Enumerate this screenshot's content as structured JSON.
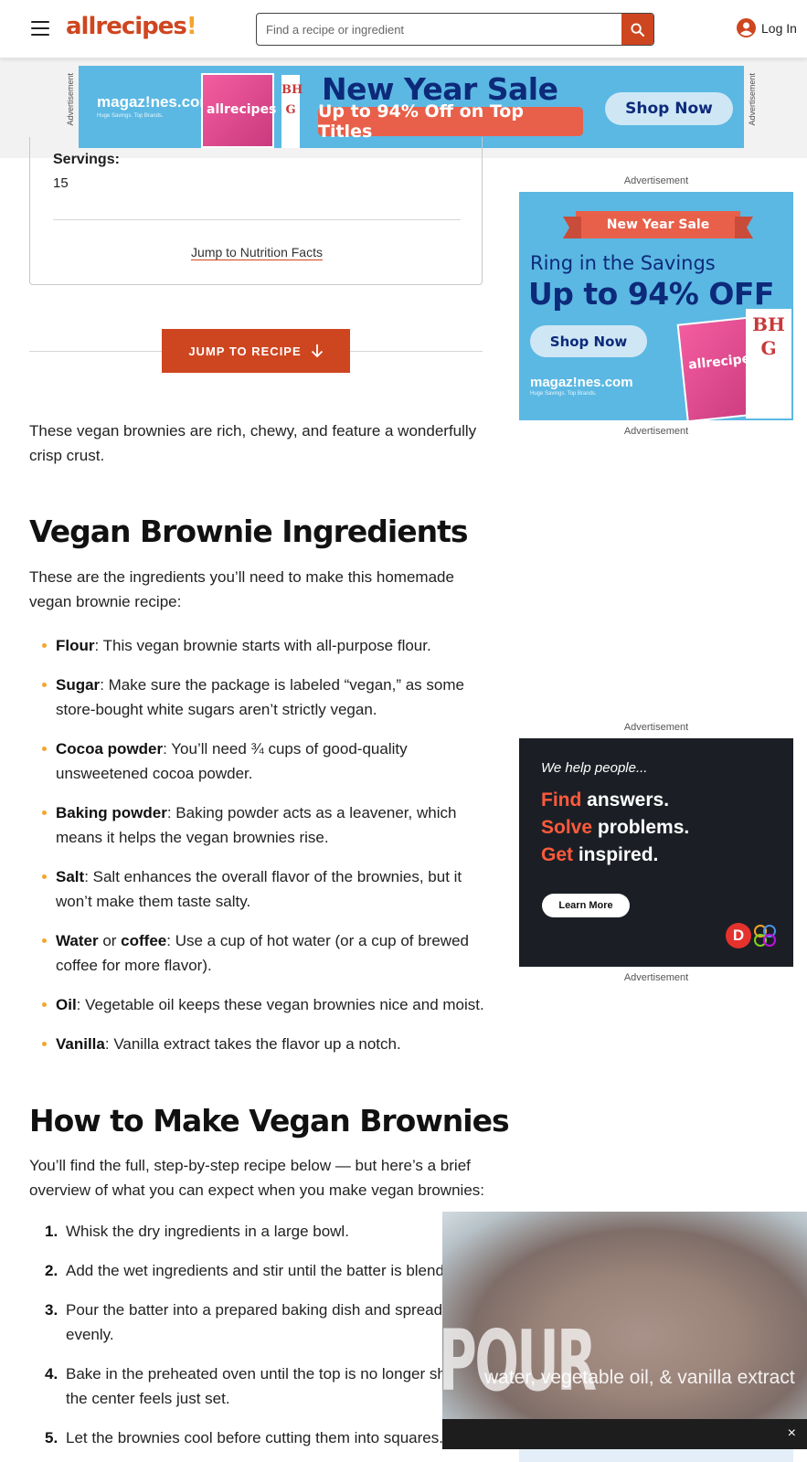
{
  "header": {
    "logo_text": "allrecipes",
    "logo_bang": "!",
    "search_placeholder": "Find a recipe or ingredient",
    "login_label": "Log In"
  },
  "top_ad": {
    "side_label": "Advertisement",
    "brand": "magaz!nes.com",
    "brand_tagline": "Huge Savings. Top Brands.",
    "cover_title": "allrecipes",
    "cover_badge": "BH G",
    "title": "New Year Sale",
    "subtitle": "Up to 94% Off on Top Titles",
    "cta": "Shop Now"
  },
  "recipe_card": {
    "servings_label": "Servings:",
    "servings_value": "15",
    "nutrition_link": "Jump to Nutrition Facts"
  },
  "jump_button": {
    "label": "JUMP TO RECIPE"
  },
  "intro": "These vegan brownies are rich, chewy, and feature a wonderfully crisp crust.",
  "ingredients_section": {
    "heading": "Vegan Brownie Ingredients",
    "intro": "These are the ingredients you’ll need to make this homemade vegan brownie recipe:",
    "items": [
      {
        "term": "Flour",
        "text": ": This vegan brownie starts with all-purpose flour."
      },
      {
        "term": "Sugar",
        "text": ": Make sure the package is labeled “vegan,” as some store-bought white sugars aren’t strictly vegan."
      },
      {
        "term": "Cocoa powder",
        "text": ": You’ll need ¾ cups of good-quality unsweetened cocoa powder."
      },
      {
        "term": "Baking powder",
        "text": ": Baking powder acts as a leavener, which means it helps the vegan brownies rise."
      },
      {
        "term": "Salt",
        "text": ": Salt enhances the overall flavor of the brownies, but it won’t make them taste salty."
      },
      {
        "term": "Water",
        "joiner": " or ",
        "term2": "coffee",
        "text": ": Use a cup of hot water (or a cup of brewed coffee for more flavor)."
      },
      {
        "term": "Oil",
        "text": ": Vegetable oil keeps these vegan brownies nice and moist."
      },
      {
        "term": "Vanilla",
        "text": ": Vanilla extract takes the flavor up a notch."
      }
    ]
  },
  "method_section": {
    "heading": "How to Make Vegan Brownies",
    "intro": "You’ll find the full, step-by-step recipe below — but here’s a brief overview of what you can expect when you make vegan brownies:",
    "steps": [
      {
        "num": "1.",
        "text": "Whisk the dry ingredients in a large bowl."
      },
      {
        "num": "2.",
        "text": "Add the wet ingredients and stir until the batter is blend"
      },
      {
        "num": "3.",
        "text": "Pour the batter into a prepared baking dish and spread it evenly."
      },
      {
        "num": "4.",
        "text": "Bake in the preheated oven until the top is no longer sh and the center feels just set."
      },
      {
        "num": "5.",
        "text": "Let the brownies cool before cutting them into squares."
      }
    ]
  },
  "side_ads": {
    "label": "Advertisement",
    "ad1": {
      "ribbon": "New Year Sale",
      "line1": "Ring in the Savings",
      "line2": "Up to 94% OFF",
      "cta": "Shop Now",
      "brand": "magaz!nes.com",
      "brand_tagline": "Huge Savings. Top Brands.",
      "cover_title": "allrecipes",
      "cover_badge": "BH G"
    },
    "ad2": {
      "tagline": "We help people...",
      "lines": [
        {
          "accent": "Find",
          "rest": " answers."
        },
        {
          "accent": "Solve",
          "rest": " problems."
        },
        {
          "accent": "Get",
          "rest": " inspired."
        }
      ],
      "cta": "Learn More",
      "logo_letter": "D"
    }
  },
  "video": {
    "overlay_title": "POUR IN",
    "overlay_caption": "water, vegetable oil, & vanilla extract",
    "close_label": "×"
  },
  "colors": {
    "brand": "#ce4620",
    "bullet": "#f2a72b",
    "ad_blue": "#5bb8e3",
    "ad_navy": "#0d2a7a",
    "ad_coral": "#e8604a",
    "dotdash_orange": "#ff5a3c"
  }
}
